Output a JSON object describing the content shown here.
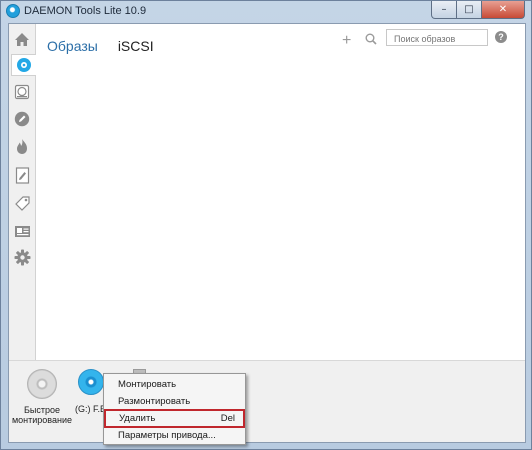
{
  "window": {
    "title": "DAEMON Tools Lite 10.9",
    "controls": {
      "minimize": "–",
      "maximize": "□",
      "close": "✕"
    }
  },
  "sidebar": {
    "items": [
      {
        "name": "home-icon",
        "active": false
      },
      {
        "name": "images-disc-icon",
        "active": true
      },
      {
        "name": "drive-icon",
        "active": false
      },
      {
        "name": "edit-pencil-icon",
        "active": false
      },
      {
        "name": "burn-flame-icon",
        "active": false
      },
      {
        "name": "image-editor-icon",
        "active": false
      },
      {
        "name": "usb-tag-icon",
        "active": false
      },
      {
        "name": "catalog-card-icon",
        "active": false
      },
      {
        "name": "settings-gear-icon",
        "active": false
      }
    ]
  },
  "header": {
    "tabs": [
      {
        "label": "Образы"
      },
      {
        "label": "iSCSI"
      }
    ],
    "add_icon": "+",
    "search": {
      "placeholder": "Поиск образов"
    },
    "help_icon": "?"
  },
  "tray": {
    "quick_mount_label": "Быстрое монтирование",
    "drive_g_label": "(G:) F.E"
  },
  "context_menu": {
    "items": [
      {
        "label": "Монтировать",
        "shortcut": ""
      },
      {
        "label": "Размонтировать",
        "shortcut": ""
      },
      {
        "label": "Удалить",
        "shortcut": "Del"
      },
      {
        "label": "Параметры привода...",
        "shortcut": ""
      }
    ]
  },
  "colors": {
    "accent": "#2c6fa8",
    "highlight_border": "#c0272d",
    "disc_blue": "#33b4ec"
  }
}
